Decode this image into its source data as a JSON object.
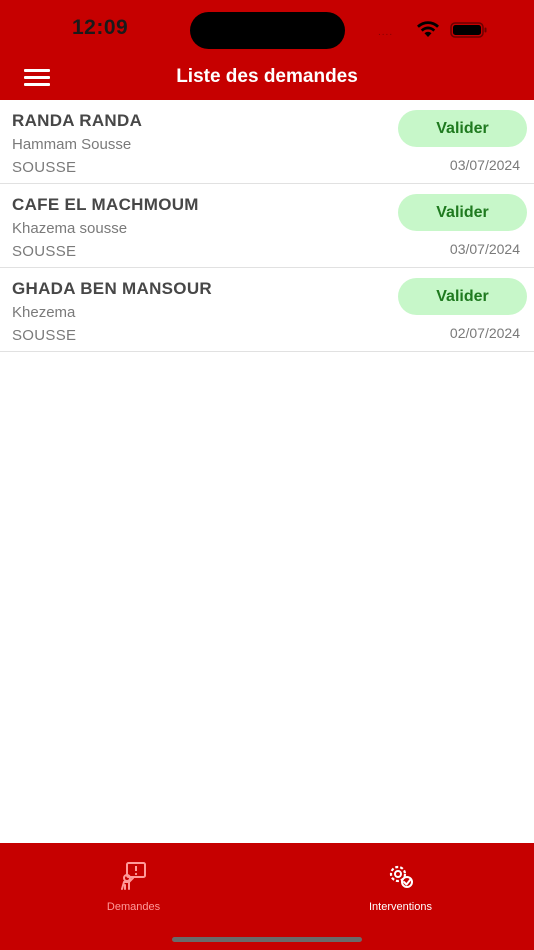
{
  "status_bar": {
    "time": "12:09",
    "signal": "....",
    "wifi_icon": "wifi-icon",
    "battery_icon": "battery-icon"
  },
  "header": {
    "title": "Liste des demandes",
    "menu_icon": "hamburger-menu-icon"
  },
  "requests": [
    {
      "name": "RANDA RANDA",
      "address": "Hammam Sousse",
      "city": "SOUSSE",
      "date": "03/07/2024",
      "action": "Valider"
    },
    {
      "name": "CAFE EL MACHMOUM",
      "address": "Khazema sousse",
      "city": "SOUSSE",
      "date": "03/07/2024",
      "action": "Valider"
    },
    {
      "name": "GHADA BEN MANSOUR",
      "address": "Khezema",
      "city": "SOUSSE",
      "date": "02/07/2024",
      "action": "Valider"
    }
  ],
  "tabbar": {
    "tabs": [
      {
        "label": "Demandes",
        "icon": "request-icon",
        "active": true
      },
      {
        "label": "Interventions",
        "icon": "interventions-gear-icon",
        "active": false
      }
    ]
  },
  "colors": {
    "brand_red": "#c60000",
    "validate_bg": "#c7f7c9",
    "validate_text": "#1f7a1f",
    "active_tab_label": "#ff9a9a"
  }
}
